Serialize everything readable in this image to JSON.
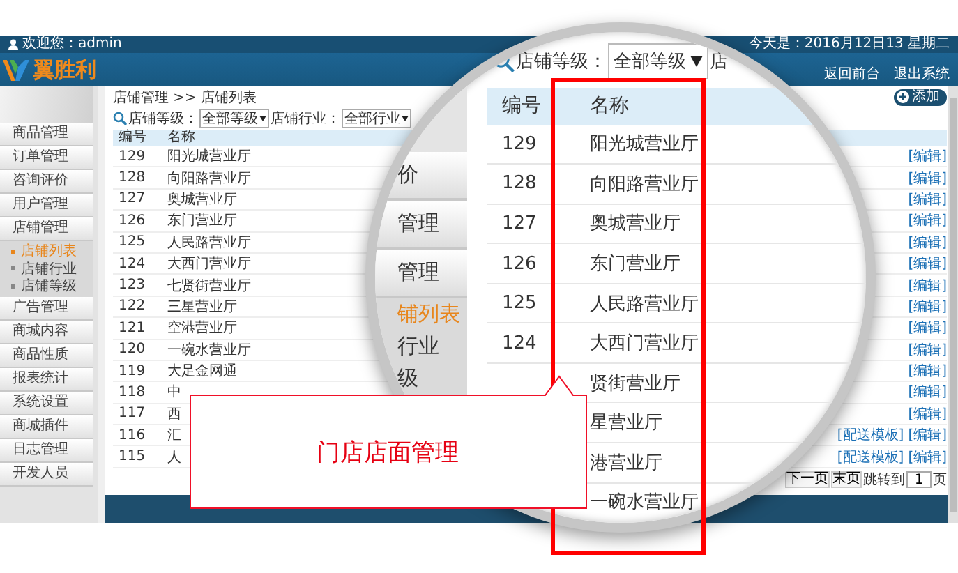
{
  "header": {
    "welcome": "欢迎您：admin",
    "logo": "翼胜利",
    "date": "今天是：2016月12日13 星期二",
    "links": [
      "返回前台",
      "退出系统"
    ]
  },
  "sidebar": {
    "items": [
      {
        "label": "商品管理"
      },
      {
        "label": "订单管理"
      },
      {
        "label": "咨询评价"
      },
      {
        "label": "用户管理"
      },
      {
        "label": "店铺管理",
        "children": [
          {
            "label": "店铺列表",
            "selected": true
          },
          {
            "label": "店铺行业",
            "selected": false
          },
          {
            "label": "店铺等级",
            "selected": false
          }
        ]
      },
      {
        "label": "广告管理"
      },
      {
        "label": "商城内容"
      },
      {
        "label": "商品性质"
      },
      {
        "label": "报表统计"
      },
      {
        "label": "系统设置"
      },
      {
        "label": "商城插件"
      },
      {
        "label": "日志管理"
      },
      {
        "label": "开发人员"
      }
    ]
  },
  "breadcrumb": "店铺管理 >> 店铺列表",
  "add_button": "添加",
  "filters": [
    {
      "label": "店铺等级：",
      "value": "全部等级"
    },
    {
      "label": "店铺行业：",
      "value": "全部行业"
    }
  ],
  "table": {
    "columns": [
      "编号",
      "名称"
    ],
    "rows": [
      {
        "id": "129",
        "name": "阳光城营业厅",
        "actions": [
          "[编辑]"
        ]
      },
      {
        "id": "128",
        "name": "向阳路营业厅",
        "actions": [
          "[编辑]"
        ]
      },
      {
        "id": "127",
        "name": "奥城营业厅",
        "actions": [
          "[编辑]"
        ]
      },
      {
        "id": "126",
        "name": "东门营业厅",
        "actions": [
          "[编辑]"
        ]
      },
      {
        "id": "125",
        "name": "人民路营业厅",
        "actions": [
          "[编辑]"
        ]
      },
      {
        "id": "124",
        "name": "大西门营业厅",
        "actions": [
          "[编辑]"
        ]
      },
      {
        "id": "123",
        "name": "七贤街营业厅",
        "actions": [
          "[编辑]"
        ]
      },
      {
        "id": "122",
        "name": "三星营业厅",
        "actions": [
          "[编辑]"
        ]
      },
      {
        "id": "121",
        "name": "空港营业厅",
        "actions": [
          "[编辑]"
        ]
      },
      {
        "id": "120",
        "name": "一碗水营业厅",
        "actions": [
          "[编辑]"
        ]
      },
      {
        "id": "119",
        "name": "大足金网通",
        "actions": [
          "[编辑]"
        ]
      },
      {
        "id": "118",
        "name": "中",
        "actions": [
          "[编辑]"
        ]
      },
      {
        "id": "117",
        "name": "西",
        "actions": [
          "[编辑]"
        ]
      },
      {
        "id": "116",
        "name": "汇",
        "actions": [
          "[配送模板]",
          "[编辑]"
        ]
      },
      {
        "id": "115",
        "name": "人",
        "actions": [
          "[配送模板]",
          "[编辑]"
        ]
      }
    ]
  },
  "pagination": {
    "buttons": [
      "下一页",
      "末页"
    ],
    "jump_label": "跳转到",
    "page": "1",
    "unit": "页"
  },
  "magnifier": {
    "side_items": [
      {
        "label": "价",
        "kind": "menu",
        "selected": false
      },
      {
        "label": "管理",
        "kind": "menu",
        "selected": false
      },
      {
        "label": "管理",
        "kind": "menu",
        "selected": false
      },
      {
        "label": "铺列表",
        "kind": "sub",
        "selected": true
      },
      {
        "label": "行业",
        "kind": "sub",
        "selected": false
      },
      {
        "label": "级",
        "kind": "sub",
        "selected": false
      }
    ],
    "filter_label": "店铺等级：",
    "filter_value": "全部等级",
    "filter_next": "店",
    "columns": [
      "编号",
      "名称"
    ],
    "rows": [
      {
        "id": "129",
        "name": "阳光城营业厅"
      },
      {
        "id": "128",
        "name": "向阳路营业厅"
      },
      {
        "id": "127",
        "name": "奥城营业厅"
      },
      {
        "id": "126",
        "name": "东门营业厅"
      },
      {
        "id": "125",
        "name": "人民路营业厅"
      },
      {
        "id": "124",
        "name": "大西门营业厅"
      },
      {
        "name": "贤街营业厅"
      },
      {
        "name": "星营业厅"
      },
      {
        "name": "港营业厅"
      },
      {
        "name": "一碗水营业厅"
      }
    ]
  },
  "callout": "门店店面管理"
}
